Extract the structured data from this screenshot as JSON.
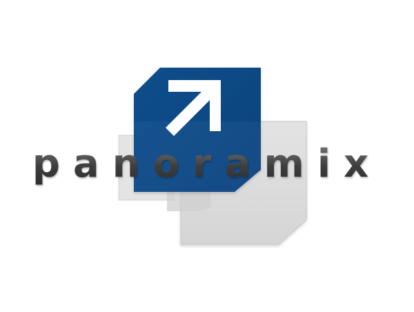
{
  "logo": {
    "name": "panoramix",
    "letters": [
      "p",
      "a",
      "n",
      "o",
      "r",
      "a",
      "m",
      "i",
      "x"
    ],
    "colors": {
      "blue": "#0b4a86",
      "blue_highlight": "#2c66a3",
      "gray_panel": "#d9d9d9",
      "gray_panel_light": "#e6e6e6",
      "text_dark": "#3a3a3a",
      "text_mid": "#6a6a6a",
      "arrow": "#ffffff"
    },
    "icons": [
      "arrow-up-right-icon"
    ]
  }
}
